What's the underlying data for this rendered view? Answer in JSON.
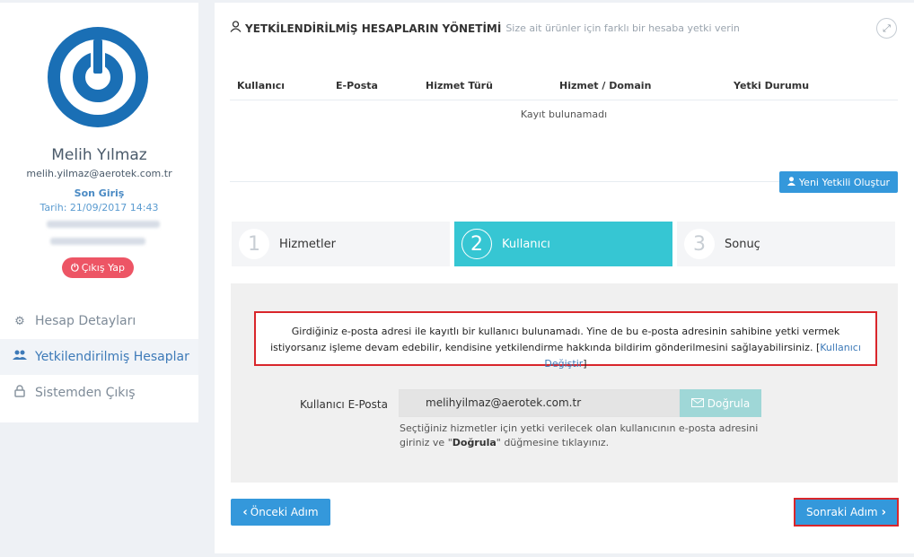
{
  "sidebar": {
    "user_name": "Melih Yılmaz",
    "user_email": "melih.yilmaz@aerotek.com.tr",
    "last_login_label": "Son Giriş",
    "login_date": "Tarih: 21/09/2017 14:43",
    "logout_label": "Çıkış Yap",
    "menu": [
      {
        "label": "Hesap Detayları",
        "icon": "gear-icon"
      },
      {
        "label": "Yetkilendirilmiş Hesaplar",
        "icon": "users-icon"
      },
      {
        "label": "Sistemden Çıkış",
        "icon": "lock-icon"
      }
    ]
  },
  "main": {
    "title": "YETKİLENDİRİLMİŞ HESAPLARIN YÖNETİMİ",
    "subtitle": "Size ait ürünler için farklı bir hesaba yetki verin",
    "table": {
      "columns": [
        "Kullanıcı",
        "E-Posta",
        "Hizmet Türü",
        "Hizmet / Domain",
        "Yetki Durumu"
      ],
      "empty_text": "Kayıt bulunamadı"
    },
    "new_button_label": "Yeni Yetkili Oluştur",
    "steps": [
      {
        "number": "1",
        "label": "Hizmetler",
        "active": false
      },
      {
        "number": "2",
        "label": "Kullanıcı",
        "active": true
      },
      {
        "number": "3",
        "label": "Sonuç",
        "active": false
      }
    ],
    "alert": {
      "text": "Girdiğiniz e-posta adresi ile kayıtlı bir kullanıcı bulunamadı. Yine de bu e-posta adresinin sahibine yetki vermek istiyorsanız işleme devam edebilir, kendisine yetkilendirme hakkında bildirim gönderilmesini sağlayabilirsiniz.",
      "link_text": "Kullanıcı Değiştir"
    },
    "form": {
      "email_label": "Kullanıcı E-Posta",
      "email_value": "melihyilmaz@aerotek.com.tr",
      "verify_label": "Doğrula",
      "help_prefix": "Seçtiğiniz hizmetler için yetki verilecek olan kullanıcının e-posta adresini giriniz ve \"",
      "help_bold": "Doğrula",
      "help_suffix": "\" düğmesine tıklayınız."
    },
    "prev_label": "Önceki Adım",
    "next_label": "Sonraki Adım"
  },
  "colors": {
    "accent": "#3498db",
    "step_active": "#36c6d3",
    "danger": "#ed5565",
    "alert_border": "#d9262b"
  }
}
